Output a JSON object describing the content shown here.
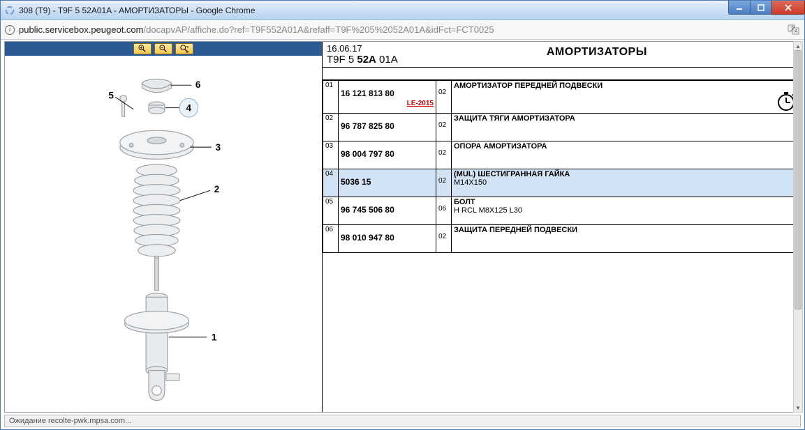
{
  "window": {
    "title": "308 (T9) - T9F 5 52A01A - АМОРТИЗАТОРЫ - Google Chrome"
  },
  "url": {
    "host": "public.servicebox.peugeot.com",
    "path": "/docapvAP/affiche.do?ref=T9F552A01A&refaff=T9F%205%2052A01A&idFct=FCT0025"
  },
  "header": {
    "date": "16.06.17",
    "code_pre": "T9F 5 ",
    "code_bold": "52A",
    "code_post": " 01A",
    "title": "АМОРТИЗАТОРЫ"
  },
  "parts": [
    {
      "num": "01",
      "partnum": "16 121 813 80",
      "qty": "02",
      "desc": "АМОРТИЗАТОР ПЕРЕДНЕЙ ПОДВЕСКИ",
      "desc2": "",
      "le": "LE-2015",
      "icon": "stopwatch"
    },
    {
      "num": "02",
      "partnum": "96 787 825 80",
      "qty": "02",
      "desc": "ЗАЩИТА ТЯГИ АМОРТИЗАТОРА",
      "desc2": "",
      "le": "",
      "icon": ""
    },
    {
      "num": "03",
      "partnum": "98 004 797 80",
      "qty": "02",
      "desc": "ОПОРА АМОРТИЗАТОРА",
      "desc2": "",
      "le": "",
      "icon": ""
    },
    {
      "num": "04",
      "partnum": "5036 15",
      "qty": "02",
      "desc": "(MUL) ШЕСТИГРАННАЯ ГАЙКА",
      "desc2": "M14X150",
      "le": "",
      "icon": "",
      "hl": true
    },
    {
      "num": "05",
      "partnum": "96 745 506 80",
      "qty": "06",
      "desc": "БОЛТ",
      "desc2": "H RCL M8X125 L30",
      "le": "",
      "icon": ""
    },
    {
      "num": "06",
      "partnum": "98 010 947 80",
      "qty": "02",
      "desc": "ЗАЩИТА ПЕРЕДНЕЙ ПОДВЕСКИ",
      "desc2": "",
      "le": "",
      "icon": ""
    }
  ],
  "callouts": {
    "n1": "1",
    "n2": "2",
    "n3": "3",
    "n4": "4",
    "n5": "5",
    "n6": "6"
  },
  "status": "Ожидание recolte-pwk.mpsa.com..."
}
